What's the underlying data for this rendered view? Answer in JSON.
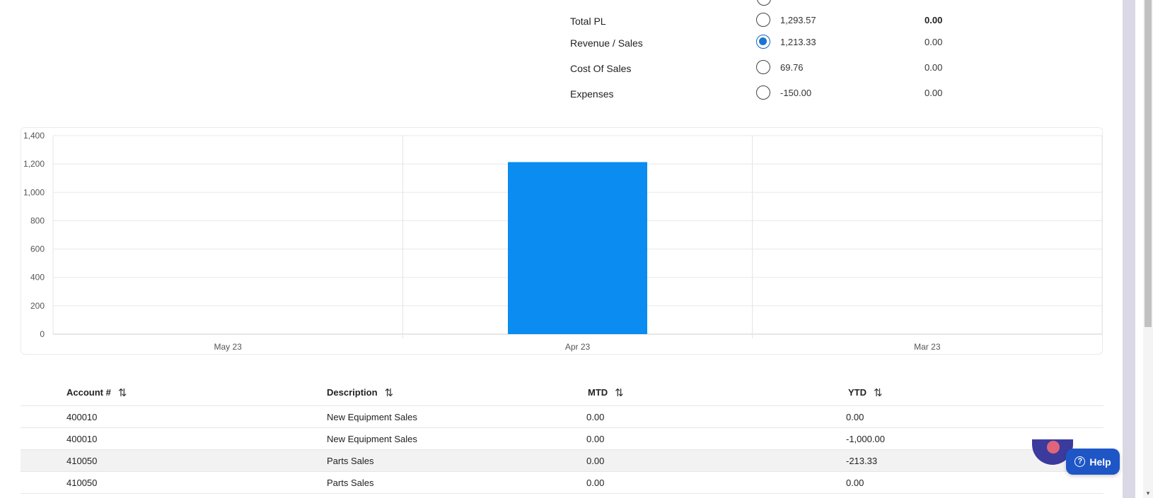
{
  "summary": {
    "rows": [
      {
        "label": "Total PL",
        "v1": "1,293.57",
        "v2": "0.00",
        "checked": false,
        "v2_bold": true
      },
      {
        "label": "Revenue / Sales",
        "v1": "1,213.33",
        "v2": "0.00",
        "checked": true,
        "v2_bold": false
      },
      {
        "label": "Cost Of Sales",
        "v1": "69.76",
        "v2": "0.00",
        "checked": false,
        "v2_bold": false
      },
      {
        "label": "Expenses",
        "v1": "-150.00",
        "v2": "0.00",
        "checked": false,
        "v2_bold": false
      }
    ]
  },
  "chart_data": {
    "type": "bar",
    "categories": [
      "May 23",
      "Apr 23",
      "Mar 23"
    ],
    "values": [
      0,
      1213.33,
      0
    ],
    "ylim": [
      0,
      1400
    ],
    "yticks": [
      "0",
      "200",
      "400",
      "600",
      "800",
      "1,000",
      "1,200",
      "1,400"
    ],
    "bar_color": "#0a8cf0",
    "grid": true
  },
  "table": {
    "headers": [
      "Account #",
      "Description",
      "MTD",
      "YTD"
    ],
    "sort_icon": "⇅",
    "rows": [
      [
        "400010",
        "New Equipment Sales",
        "0.00",
        "0.00"
      ],
      [
        "400010",
        "New Equipment Sales",
        "0.00",
        "-1,000.00"
      ],
      [
        "410050",
        "Parts Sales",
        "0.00",
        "-213.33"
      ],
      [
        "410050",
        "Parts Sales",
        "0.00",
        "0.00"
      ]
    ]
  },
  "help": {
    "label": "Help",
    "icon_glyph": "?"
  },
  "scrollbar": {
    "down_arrow": "▾"
  }
}
